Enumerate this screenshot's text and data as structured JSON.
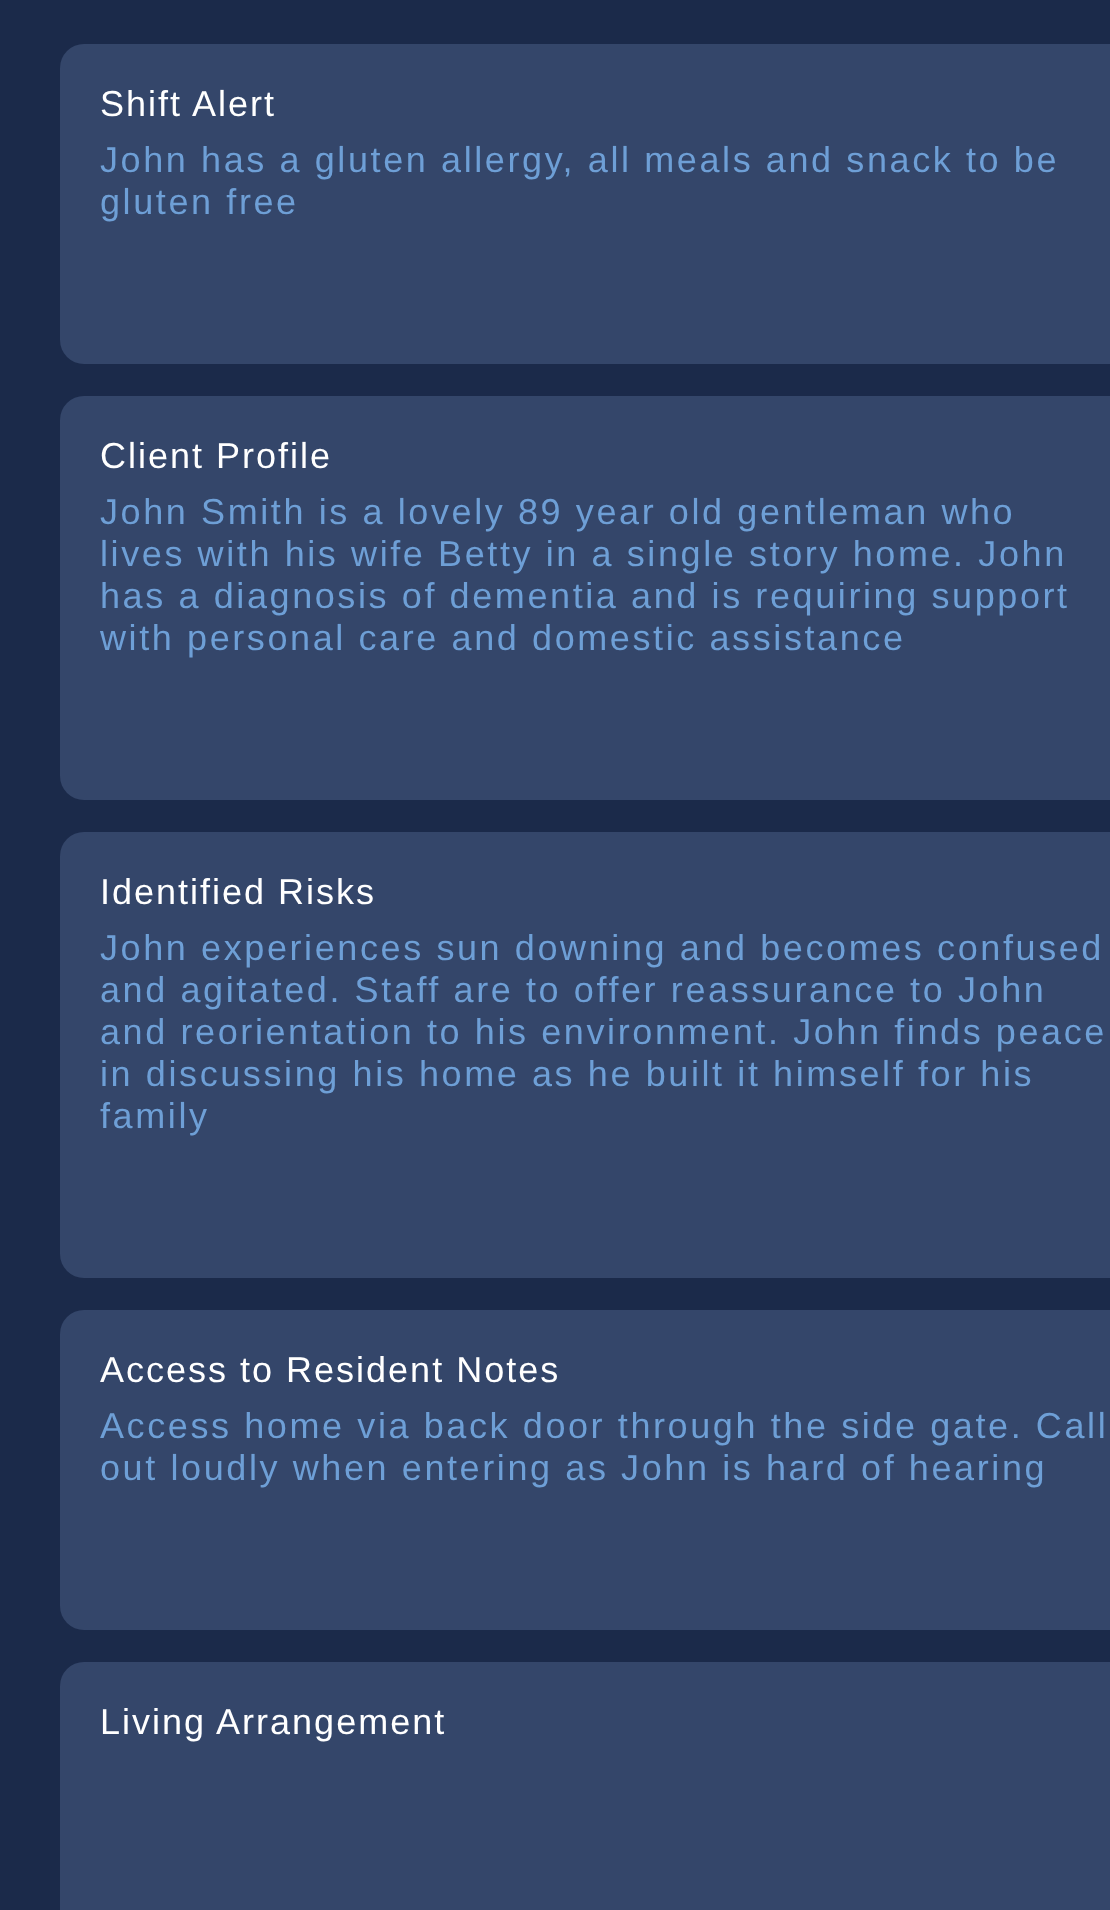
{
  "cards": [
    {
      "title": "Shift Alert",
      "body": "John has a gluten allergy, all meals and snack to be gluten free"
    },
    {
      "title": "Client Profile",
      "body": "John Smith is a lovely 89 year old gentleman who lives with his wife Betty in a single story home. John has a diagnosis of dementia and is requiring support with personal care and domestic assistance"
    },
    {
      "title": "Identified Risks",
      "body": "John experiences sun downing and becomes confused and agitated. Staff are to offer reassurance to John and reorientation to his environment. John finds peace in discussing his home as he built it himself for his family"
    },
    {
      "title": "Access to Resident Notes",
      "body": "Access home via back door through the side gate. Call out loudly when entering as John is hard of hearing"
    },
    {
      "title": "Living Arrangement"
    }
  ]
}
